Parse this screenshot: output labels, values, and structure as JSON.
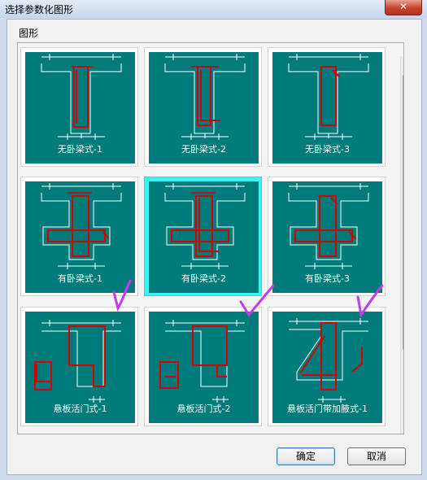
{
  "window": {
    "title": "选择参数化图形",
    "close_glyph": "✕"
  },
  "group_label": "图形",
  "tiles": [
    {
      "label": "无卧梁式-1"
    },
    {
      "label": "无卧梁式-2"
    },
    {
      "label": "无卧梁式-3"
    },
    {
      "label": "有卧梁式-1"
    },
    {
      "label": "有卧梁式-2"
    },
    {
      "label": "有卧梁式-3"
    },
    {
      "label": "悬板活门式-1"
    },
    {
      "label": "悬板活门式-2"
    },
    {
      "label": "悬板活门带加腋式-1"
    }
  ],
  "selected_tile": "有卧梁式-2",
  "buttons": {
    "ok": "确定",
    "cancel": "取消"
  },
  "colors": {
    "tile_bg": "#007b7b",
    "rebar": "#d40000",
    "outline": "#ffffff",
    "selection": "#3ff2f2",
    "check_mark": "#c43cf0"
  }
}
